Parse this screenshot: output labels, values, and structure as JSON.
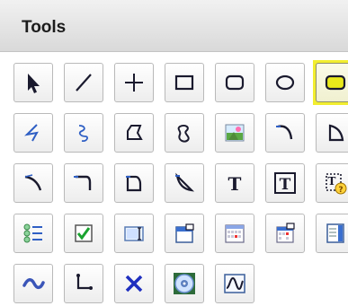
{
  "panel": {
    "title": "Tools"
  },
  "tools": [
    {
      "icon": "arrow-pointer-icon",
      "name": "tool-select"
    },
    {
      "icon": "line-icon",
      "name": "tool-line"
    },
    {
      "icon": "crosshair-icon",
      "name": "tool-cross"
    },
    {
      "icon": "rectangle-icon",
      "name": "tool-rectangle"
    },
    {
      "icon": "rounded-rectangle-icon",
      "name": "tool-rounded-rectangle"
    },
    {
      "icon": "ellipse-icon",
      "name": "tool-ellipse"
    },
    {
      "icon": "filled-rounded-rectangle-icon",
      "name": "tool-filled-rounded-rectangle",
      "selected": true
    },
    {
      "icon": "polyline-icon",
      "name": "tool-polyline"
    },
    {
      "icon": "freehand-curve-icon",
      "name": "tool-freehand-curve"
    },
    {
      "icon": "polygon-icon",
      "name": "tool-polygon"
    },
    {
      "icon": "closed-curve-icon",
      "name": "tool-closed-curve"
    },
    {
      "icon": "image-icon",
      "name": "tool-image"
    },
    {
      "icon": "arc-icon",
      "name": "tool-arc"
    },
    {
      "icon": "chord-icon",
      "name": "tool-chord"
    },
    {
      "icon": "bezier-icon",
      "name": "tool-bezier"
    },
    {
      "icon": "elbow-connector-icon",
      "name": "tool-elbow-connector"
    },
    {
      "icon": "rounded-corner-shape-icon",
      "name": "tool-rounded-corner-shape"
    },
    {
      "icon": "curved-wedge-icon",
      "name": "tool-curved-wedge"
    },
    {
      "icon": "text-icon",
      "name": "tool-text"
    },
    {
      "icon": "text-box-icon",
      "name": "tool-text-box"
    },
    {
      "icon": "field-placeholder-icon",
      "name": "tool-field-placeholder"
    },
    {
      "icon": "list-icon",
      "name": "tool-list"
    },
    {
      "icon": "checkbox-icon",
      "name": "tool-checkbox"
    },
    {
      "icon": "text-input-icon",
      "name": "tool-text-input"
    },
    {
      "icon": "dialog-frame-icon",
      "name": "tool-dialog-frame"
    },
    {
      "icon": "calendar-icon",
      "name": "tool-calendar"
    },
    {
      "icon": "date-picker-icon",
      "name": "tool-date-picker"
    },
    {
      "icon": "scroll-panel-icon",
      "name": "tool-scroll-panel"
    },
    {
      "icon": "wave-icon",
      "name": "tool-wave"
    },
    {
      "icon": "step-connector-icon",
      "name": "tool-step-connector"
    },
    {
      "icon": "delete-x-icon",
      "name": "tool-delete"
    },
    {
      "icon": "media-disc-icon",
      "name": "tool-media-disc"
    },
    {
      "icon": "waveform-chart-icon",
      "name": "tool-waveform-chart"
    }
  ],
  "colors": {
    "highlight": "#f2ee2f",
    "icon_blue": "#2f5fc4",
    "icon_dark": "#1a1a2e"
  }
}
